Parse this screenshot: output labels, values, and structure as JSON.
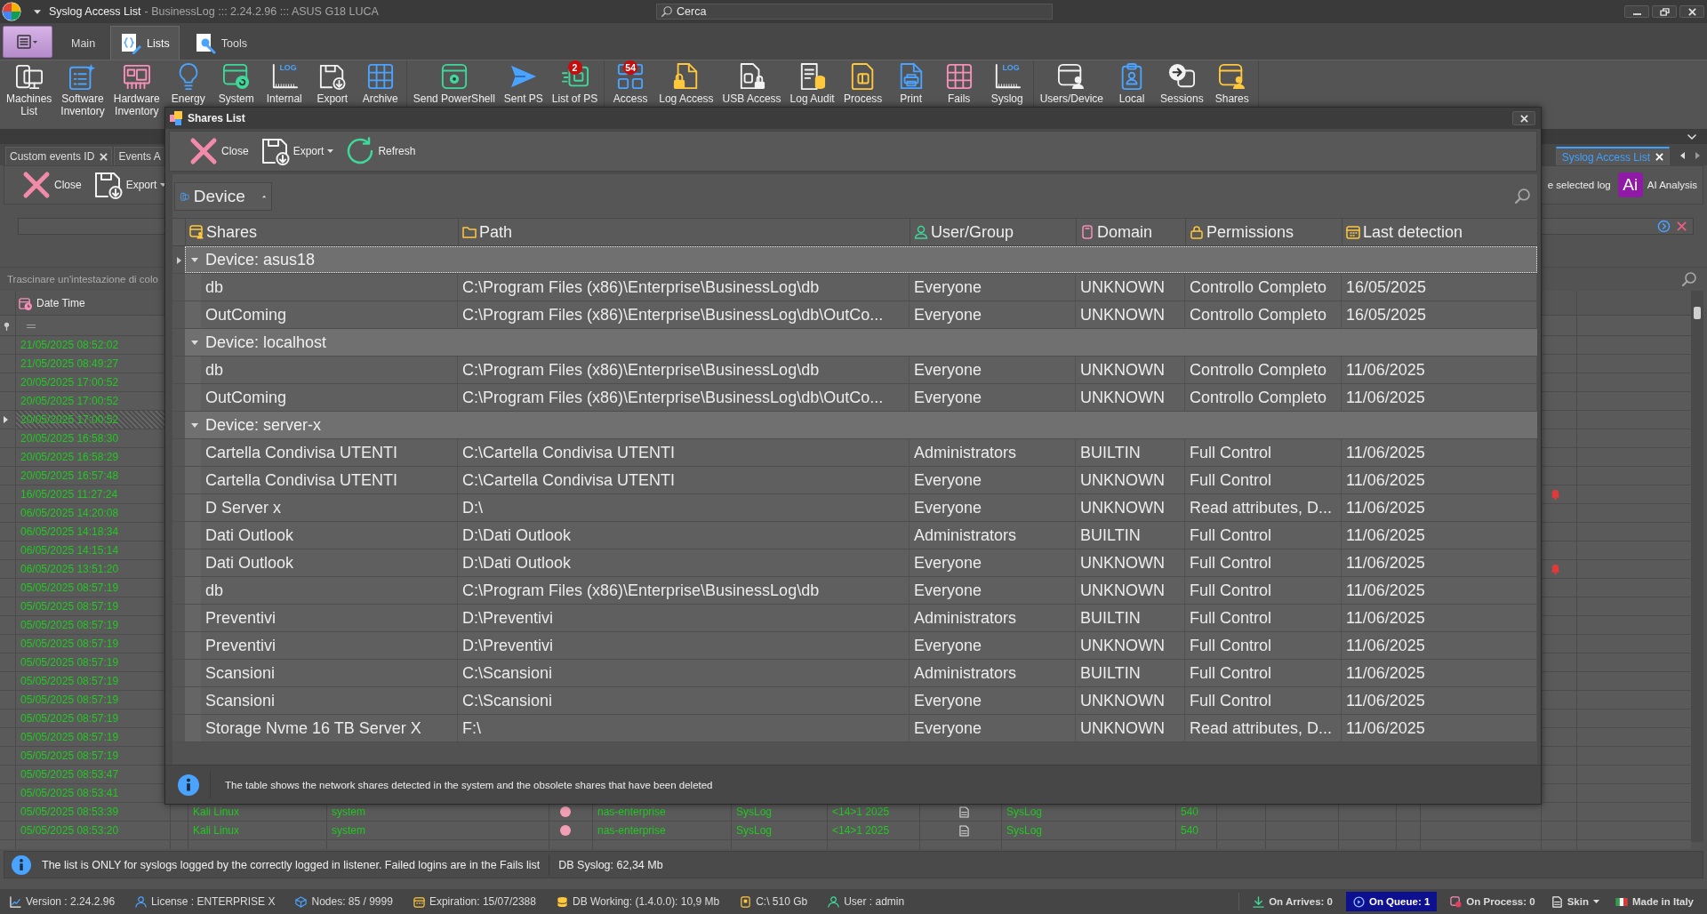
{
  "window": {
    "title": "Syslog Access List",
    "subtitle": "- BusinessLog ::: 2.24.2.96 ::: ASUS G18 LUCA",
    "search": {
      "placeholder": "Cerca"
    }
  },
  "ribbon": {
    "tabs": [
      {
        "label": "Main",
        "selected": false
      },
      {
        "label": "Lists",
        "selected": true
      },
      {
        "label": "Tools",
        "selected": false
      }
    ],
    "groups": [
      {
        "buttons": [
          {
            "label": "Machines\nList"
          },
          {
            "label": "Software\nInventory"
          },
          {
            "label": "Hardware\nInventory"
          },
          {
            "label": "Energy"
          },
          {
            "label": "System"
          },
          {
            "label": "Internal",
            "icon_text": "LOG"
          },
          {
            "label": "Export"
          },
          {
            "label": "Archive"
          }
        ]
      },
      {
        "buttons": [
          {
            "label": "Send PowerShell"
          },
          {
            "label": "Sent PS"
          },
          {
            "label": "List of PS",
            "badge": "2"
          }
        ]
      },
      {
        "buttons": [
          {
            "label": "Access",
            "badge": "54"
          },
          {
            "label": "Log Access"
          },
          {
            "label": "USB Access"
          },
          {
            "label": "Log Audit"
          },
          {
            "label": "Process"
          },
          {
            "label": "Print"
          },
          {
            "label": "Fails"
          },
          {
            "label": "Syslog",
            "icon_text": "LOG"
          }
        ]
      },
      {
        "buttons": [
          {
            "label": "Users/Device"
          },
          {
            "label": "Local"
          },
          {
            "label": "Sessions"
          },
          {
            "label": "Shares"
          }
        ]
      }
    ]
  },
  "documents": {
    "tabs": [
      {
        "label": "Custom events ID",
        "selected": false,
        "closable": true
      },
      {
        "label": "Events A",
        "selected": false,
        "closable": false
      },
      {
        "label": "Syslog Access List",
        "selected": true,
        "closable": true
      }
    ],
    "toolbar": [
      {
        "label": "Close",
        "dropdown": false
      },
      {
        "label": "Export",
        "dropdown": true
      }
    ],
    "partial_button": {
      "label": "e selected log"
    },
    "ai_button": {
      "logo": "Ai",
      "label": "AI Analysis"
    }
  },
  "log_grid": {
    "group_hint": "Trascinare un'intestazione di colo",
    "columns": [
      {
        "label": "Date Time"
      }
    ],
    "rows": [
      {
        "date_time": "21/05/2025 08:52:02",
        "selected": false,
        "alert": false
      },
      {
        "date_time": "21/05/2025 08:49:27",
        "selected": false,
        "alert": false
      },
      {
        "date_time": "20/05/2025 17:00:52",
        "selected": false,
        "alert": false
      },
      {
        "date_time": "20/05/2025 17:00:52",
        "selected": false,
        "alert": false
      },
      {
        "date_time": "20/05/2025 17:00:52",
        "selected": true,
        "alert": false
      },
      {
        "date_time": "20/05/2025 16:58:30",
        "selected": false,
        "alert": false
      },
      {
        "date_time": "20/05/2025 16:58:29",
        "selected": false,
        "alert": false
      },
      {
        "date_time": "20/05/2025 16:57:48",
        "selected": false,
        "alert": false
      },
      {
        "date_time": "16/05/2025 11:27:24",
        "selected": false,
        "alert": true
      },
      {
        "date_time": "06/05/2025 14:20:08",
        "selected": false,
        "alert": false
      },
      {
        "date_time": "06/05/2025 14:18:34",
        "selected": false,
        "alert": false
      },
      {
        "date_time": "06/05/2025 14:15:14",
        "selected": false,
        "alert": false
      },
      {
        "date_time": "06/05/2025 13:51:20",
        "selected": false,
        "alert": true
      },
      {
        "date_time": "05/05/2025 08:57:19",
        "selected": false,
        "alert": false
      },
      {
        "date_time": "05/05/2025 08:57:19",
        "selected": false,
        "alert": false
      },
      {
        "date_time": "05/05/2025 08:57:19",
        "selected": false,
        "alert": false
      },
      {
        "date_time": "05/05/2025 08:57:19",
        "selected": false,
        "alert": false
      },
      {
        "date_time": "05/05/2025 08:57:19",
        "selected": false,
        "alert": false
      },
      {
        "date_time": "05/05/2025 08:57:19",
        "selected": false,
        "alert": false
      },
      {
        "date_time": "05/05/2025 08:57:19",
        "selected": false,
        "alert": false
      },
      {
        "date_time": "05/05/2025 08:57:19",
        "selected": false,
        "alert": false
      },
      {
        "date_time": "05/05/2025 08:57:19",
        "selected": false,
        "alert": false
      },
      {
        "date_time": "05/05/2025 08:57:19",
        "selected": false,
        "alert": false
      },
      {
        "date_time": "05/05/2025 08:53:47",
        "selected": false,
        "alert": false
      },
      {
        "date_time": "05/05/2025 08:53:41",
        "selected": false,
        "alert": false
      },
      {
        "date_time": "05/05/2025 08:53:39",
        "selected": false,
        "alert": false,
        "cells": [
          "Kali Linux",
          "system",
          "nas-enterprise",
          "SysLog",
          "<14>1 2025",
          "SysLog",
          "540"
        ]
      },
      {
        "date_time": "05/05/2025 08:53:20",
        "selected": false,
        "alert": false,
        "cells": [
          "Kali Linux",
          "system",
          "nas-enterprise",
          "SysLog",
          "<14>1 2025",
          "SysLog",
          "540"
        ]
      }
    ]
  },
  "shares_dialog": {
    "title": "Shares List",
    "toolbar": [
      {
        "label": "Close",
        "dropdown": false
      },
      {
        "label": "Export",
        "dropdown": true
      },
      {
        "label": "Refresh",
        "dropdown": false
      }
    ],
    "group_by": {
      "label": "Device",
      "sort_ascending": true
    },
    "columns": [
      "Shares",
      "Path",
      "User/Group",
      "Domain",
      "Permissions",
      "Last detection"
    ],
    "groups": [
      {
        "label": "Device: asus18",
        "expanded": true,
        "selected": true,
        "rows": [
          [
            "db",
            "C:\\Program Files (x86)\\Enterprise\\BusinessLog\\db",
            "Everyone",
            "UNKNOWN",
            "Controllo Completo",
            "16/05/2025"
          ],
          [
            "OutComing",
            "C:\\Program Files (x86)\\Enterprise\\BusinessLog\\db\\OutCo...",
            "Everyone",
            "UNKNOWN",
            "Controllo Completo",
            "16/05/2025"
          ]
        ]
      },
      {
        "label": "Device: localhost",
        "expanded": true,
        "selected": false,
        "rows": [
          [
            "db",
            "C:\\Program Files (x86)\\Enterprise\\BusinessLog\\db",
            "Everyone",
            "UNKNOWN",
            "Controllo Completo",
            "11/06/2025"
          ],
          [
            "OutComing",
            "C:\\Program Files (x86)\\Enterprise\\BusinessLog\\db\\OutCo...",
            "Everyone",
            "UNKNOWN",
            "Controllo Completo",
            "11/06/2025"
          ]
        ]
      },
      {
        "label": "Device: server-x",
        "expanded": true,
        "selected": false,
        "rows": [
          [
            "Cartella Condivisa UTENTI",
            "C:\\Cartella Condivisa UTENTI",
            "Administrators",
            "BUILTIN",
            "Full Control",
            "11/06/2025"
          ],
          [
            "Cartella Condivisa UTENTI",
            "C:\\Cartella Condivisa UTENTI",
            "Everyone",
            "UNKNOWN",
            "Full Control",
            "11/06/2025"
          ],
          [
            "D Server x",
            "D:\\",
            "Everyone",
            "UNKNOWN",
            "Read attributes, D...",
            "11/06/2025"
          ],
          [
            "Dati Outlook",
            "D:\\Dati Outlook",
            "Administrators",
            "BUILTIN",
            "Full Control",
            "11/06/2025"
          ],
          [
            "Dati Outlook",
            "D:\\Dati Outlook",
            "Everyone",
            "UNKNOWN",
            "Full Control",
            "11/06/2025"
          ],
          [
            "db",
            "C:\\Program Files (x86)\\Enterprise\\BusinessLog\\db",
            "Everyone",
            "UNKNOWN",
            "Full Control",
            "11/06/2025"
          ],
          [
            "Preventivi",
            "D:\\Preventivi",
            "Administrators",
            "BUILTIN",
            "Full Control",
            "11/06/2025"
          ],
          [
            "Preventivi",
            "D:\\Preventivi",
            "Everyone",
            "UNKNOWN",
            "Full Control",
            "11/06/2025"
          ],
          [
            "Scansioni",
            "C:\\Scansioni",
            "Administrators",
            "BUILTIN",
            "Full Control",
            "11/06/2025"
          ],
          [
            "Scansioni",
            "C:\\Scansioni",
            "Everyone",
            "UNKNOWN",
            "Full Control",
            "11/06/2025"
          ],
          [
            "Storage Nvme 16 TB Server X",
            "F:\\",
            "Everyone",
            "UNKNOWN",
            "Read attributes, D...",
            "11/06/2025"
          ]
        ]
      }
    ],
    "footer": "The table shows the network shares detected in the system and the obsolete shares that have been deleted"
  },
  "info": {
    "message": "The list is ONLY for syslogs logged by the correctly logged in listener. Failed logins are in the Fails list",
    "db_size": "DB Syslog: 62,34 Mb"
  },
  "status_bar": {
    "left": [
      {
        "label": "Version : 2.24.2.96"
      },
      {
        "label": "License : ENTERPRISE X"
      },
      {
        "label": "Nodes: 85 / 9999"
      },
      {
        "label": "Expiration: 15/07/2388"
      },
      {
        "label": "DB Working: (1.4.0.0): 10,9 Mb"
      },
      {
        "label": "C:\\ 510 Gb"
      },
      {
        "label": "User : admin"
      }
    ],
    "right": [
      {
        "label": "On Arrives: 0",
        "active": false,
        "dropdown": false
      },
      {
        "label": "On Queue: 1",
        "active": true,
        "dropdown": false
      },
      {
        "label": "On Process: 0",
        "active": false,
        "dropdown": false
      },
      {
        "label": "Skin",
        "active": false,
        "dropdown": true
      },
      {
        "label": "Made in Italy",
        "active": false,
        "dropdown": false
      }
    ]
  }
}
